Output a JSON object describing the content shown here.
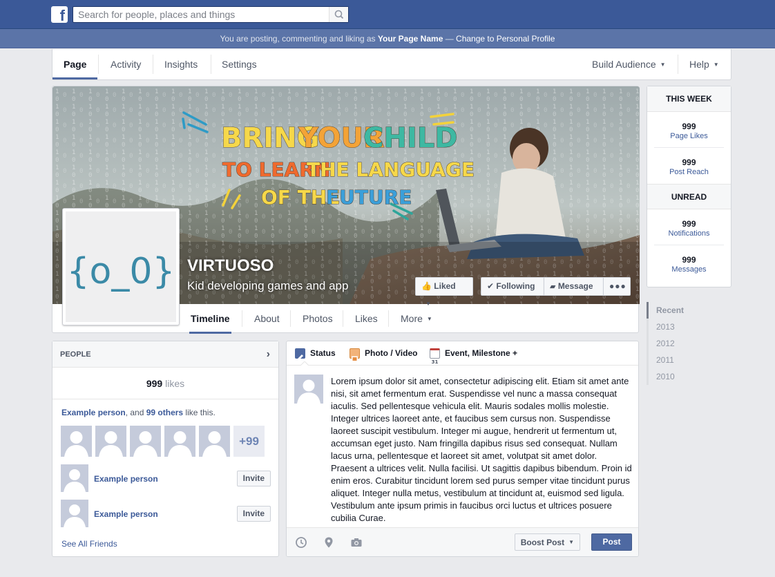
{
  "topbar": {
    "logo": "f",
    "search_placeholder": "Search for people, places and things"
  },
  "posting_bar": {
    "prefix": "You are posting, commenting and liking as ",
    "page_name": "Your Page Name",
    "separator": " — ",
    "link": "Change to Personal Profile"
  },
  "page_nav": {
    "tabs": [
      "Page",
      "Activity",
      "Insights",
      "Settings"
    ],
    "right": [
      "Build Audience",
      "Help"
    ]
  },
  "cover": {
    "headline_1": [
      "BRING",
      "YOUR",
      "CHILD"
    ],
    "headline_2": [
      "TO LEARN",
      "THE LANGUAGE"
    ],
    "headline_3": [
      "OF THE",
      "FUTURE"
    ],
    "profile_logo": "{o_0}",
    "page_name": "VIRTUOSO",
    "description": "Kid developing games and app",
    "buttons": {
      "liked": "Liked",
      "following": "Following",
      "message": "Message"
    }
  },
  "timeline_tabs": [
    "Timeline",
    "About",
    "Photos",
    "Likes",
    "More"
  ],
  "stats": {
    "this_week": "THIS WEEK",
    "page_likes": {
      "num": "999",
      "label": "Page Likes"
    },
    "post_reach": {
      "num": "999",
      "label": "Post Reach"
    },
    "unread": "UNREAD",
    "notifications": {
      "num": "999",
      "label": "Notifications"
    },
    "messages": {
      "num": "999",
      "label": "Messages"
    }
  },
  "years": [
    "Recent",
    "2013",
    "2012",
    "2011",
    "2010"
  ],
  "people": {
    "header": "PEOPLE",
    "likes_num": "999",
    "likes_word": " likes",
    "like_person": "Example person",
    "like_mid": ", and ",
    "like_others": "99 others",
    "like_end": " like this.",
    "plus": "+99",
    "suggestions": [
      {
        "name": "Example person",
        "action": "Invite"
      },
      {
        "name": "Example person",
        "action": "Invite"
      }
    ],
    "see_all": "See All Friends"
  },
  "composer": {
    "tabs": [
      "Status",
      "Photo / Video",
      "Event, Milestone +"
    ],
    "text": "Lorem ipsum dolor sit amet, consectetur adipiscing elit. Etiam sit amet ante nisi, sit amet fermentum erat. Suspendisse vel nunc a massa consequat iaculis. Sed pellentesque vehicula elit. Mauris sodales mollis molestie. Integer ultrices laoreet ante, et faucibus sem cursus non. Suspendisse laoreet suscipit vestibulum. Integer mi augue, hendrerit ut fermentum ut, accumsan eget justo. Nam fringilla dapibus risus sed consequat. Nullam lacus urna, pellentesque et laoreet sit amet, volutpat sit amet dolor. Praesent a ultrices velit. Nulla facilisi. Ut sagittis dapibus bibendum. Proin id enim eros. Curabitur tincidunt lorem sed purus semper vitae tincidunt purus aliquet. Integer nulla metus, vestibulum at tincidunt at, euismod sed ligula. Vestibulum ante ipsum primis in faucibus orci luctus et ultrices posuere cubilia Curae.",
    "boost": "Boost Post",
    "post": "Post",
    "calendar_day": "31"
  },
  "colors": {
    "facebook_blue": "#3b5998",
    "accent": "#4e69a2",
    "text": "#141823"
  }
}
